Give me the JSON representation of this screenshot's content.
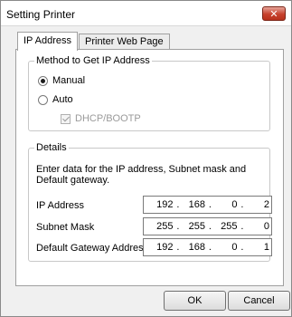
{
  "window": {
    "title": "Setting Printer",
    "close_glyph": "✕"
  },
  "tabs": [
    {
      "label": "IP Address",
      "active": true
    },
    {
      "label": "Printer Web Page",
      "active": false
    }
  ],
  "method_group": {
    "title": "Method to Get IP Address",
    "options": [
      {
        "label": "Manual",
        "selected": true
      },
      {
        "label": "Auto",
        "selected": false
      }
    ],
    "dhcp": {
      "label": "DHCP/BOOTP",
      "checked": true,
      "enabled": false
    }
  },
  "details_group": {
    "title": "Details",
    "description": "Enter data for the IP address, Subnet mask and Default gateway.",
    "fields": [
      {
        "label": "IP Address",
        "octets": [
          "192",
          "168",
          "0",
          "2"
        ]
      },
      {
        "label": "Subnet Mask",
        "octets": [
          "255",
          "255",
          "255",
          "0"
        ]
      },
      {
        "label": "Default Gateway Address",
        "octets": [
          "192",
          "168",
          "0",
          "1"
        ]
      }
    ],
    "separator": "."
  },
  "buttons": {
    "ok": "OK",
    "cancel": "Cancel"
  }
}
